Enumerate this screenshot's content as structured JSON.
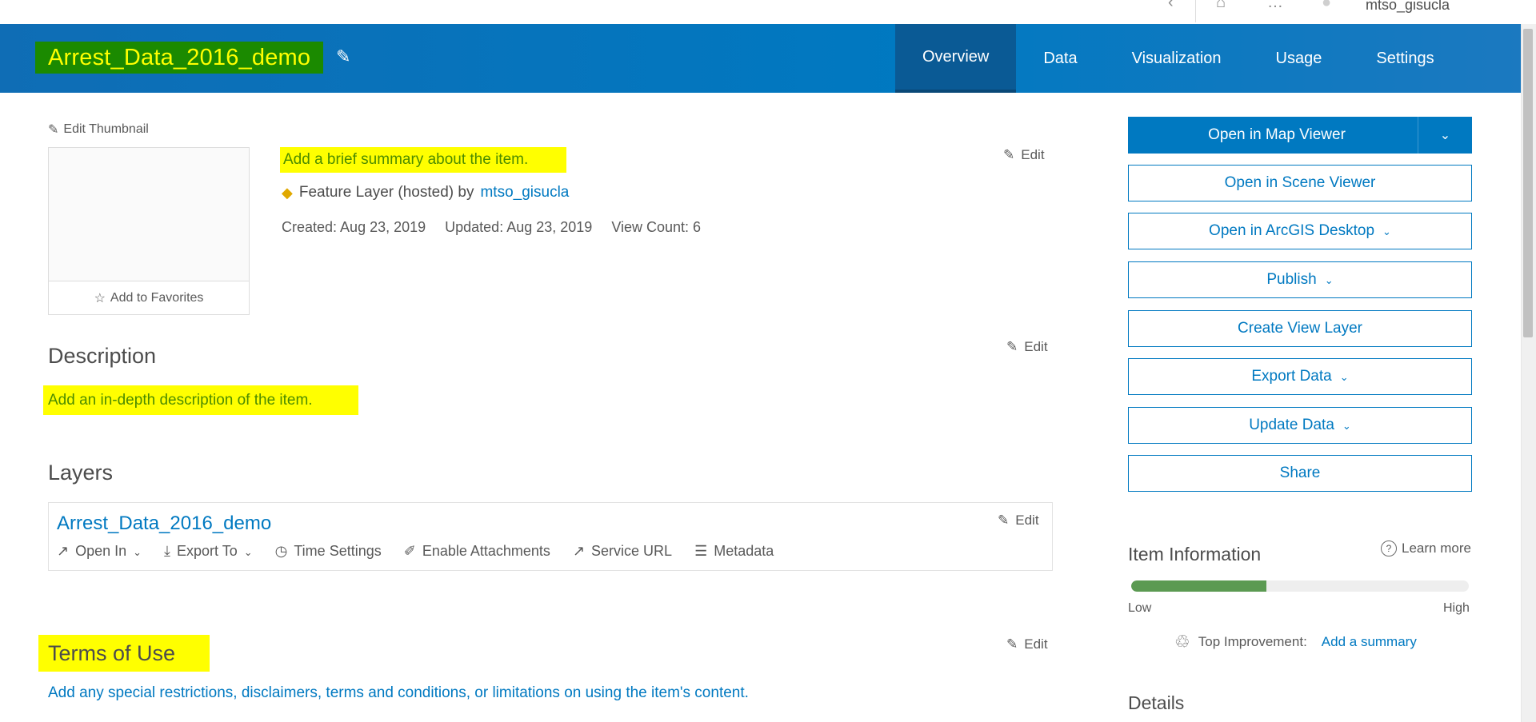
{
  "header": {
    "user_name": "mtso_gisucla",
    "title": "Arrest_Data_2016_demo",
    "tabs": [
      {
        "label": "Overview",
        "active": true
      },
      {
        "label": "Data",
        "active": false
      },
      {
        "label": "Visualization",
        "active": false
      },
      {
        "label": "Usage",
        "active": false
      },
      {
        "label": "Settings",
        "active": false
      }
    ],
    "icons": [
      "back-icon",
      "bell-icon",
      "more-icon",
      "avatar"
    ]
  },
  "thumbnail": {
    "edit_label": "Edit Thumbnail",
    "favorites_label": "Add to Favorites"
  },
  "summary": {
    "text": "Add a brief summary about the item.",
    "item_type": "Feature Layer (hosted) by",
    "owner": "mtso_gisucla",
    "created": "Created: Aug 23, 2019",
    "updated": "Updated: Aug 23, 2019",
    "view_count": "View Count: 6",
    "edit_label": "Edit"
  },
  "description": {
    "heading": "Description",
    "text": "Add an in-depth description of the item.",
    "edit_label": "Edit"
  },
  "layers": {
    "heading": "Layers",
    "layer_name": "Arrest_Data_2016_demo",
    "edit_label": "Edit",
    "actions": {
      "open_in": "Open In",
      "export_to": "Export To",
      "time_settings": "Time Settings",
      "enable_attachments": "Enable Attachments",
      "service_url": "Service URL",
      "metadata": "Metadata"
    }
  },
  "terms": {
    "heading": "Terms of Use",
    "text": "Add any special restrictions, disclaimers, terms and conditions, or limitations on using the item's content.",
    "edit_label": "Edit"
  },
  "sidebar": {
    "open_map_viewer": "Open in Map Viewer",
    "open_scene_viewer": "Open in Scene Viewer",
    "open_desktop": "Open in ArcGIS Desktop",
    "publish": "Publish",
    "create_view_layer": "Create View Layer",
    "export_data": "Export Data",
    "update_data": "Update Data",
    "share": "Share"
  },
  "item_information": {
    "heading": "Item Information",
    "learn_more": "Learn more",
    "score_fraction": 0.4,
    "low_label": "Low",
    "high_label": "High",
    "top_improvement_label": "Top Improvement:",
    "top_improvement_link": "Add a summary"
  },
  "details": {
    "heading": "Details"
  },
  "colors": {
    "header_blue": "#0079c1",
    "highlight_yellow": "#ffff00",
    "title_green": "#1b8a00",
    "progress_green": "#5b9a52"
  }
}
